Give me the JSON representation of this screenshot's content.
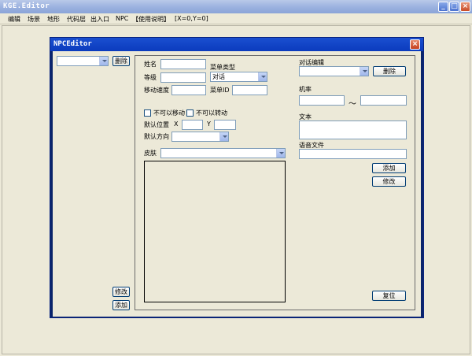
{
  "window": {
    "title": "KGE.Editor"
  },
  "menu": [
    "编辑",
    "场景",
    "地形",
    "代码层",
    "出入口",
    "NPC",
    "【使用说明】",
    "[X=0,Y=0]"
  ],
  "dialog": {
    "title": "NPCEditor",
    "left": {
      "npc_combo": "",
      "delete_label": "删除",
      "modify_label": "修改",
      "add_label": "添加"
    },
    "form": {
      "name_label": "姓名",
      "name_value": "",
      "level_label": "等级",
      "level_value": "",
      "speed_label": "移动速度",
      "speed_value": "",
      "menu_type_label": "菜单类型",
      "menu_type_value": "对话",
      "menu_id_label": "菜单ID",
      "menu_id_value": "",
      "no_move_label": "不可以移动",
      "no_move_checked": false,
      "no_turn_label": "不可以转动",
      "no_turn_checked": false,
      "default_pos_label": "默认位置",
      "x_label": "X",
      "x_value": "",
      "y_label": "Y",
      "y_value": "",
      "default_dir_label": "默认方向",
      "default_dir_value": "",
      "skin_label": "皮肤",
      "skin_value": ""
    },
    "dialogue": {
      "edit_label": "对话编辑",
      "edit_value": "",
      "delete_label": "删除",
      "prob_label": "机率",
      "prob_min": "",
      "tilde": "～",
      "prob_max": "",
      "text_label": "文本",
      "text_value": "",
      "voice_label": "语音文件",
      "voice_value": "",
      "add_label": "添加",
      "modify_label": "修改",
      "reset_label": "复位"
    }
  }
}
